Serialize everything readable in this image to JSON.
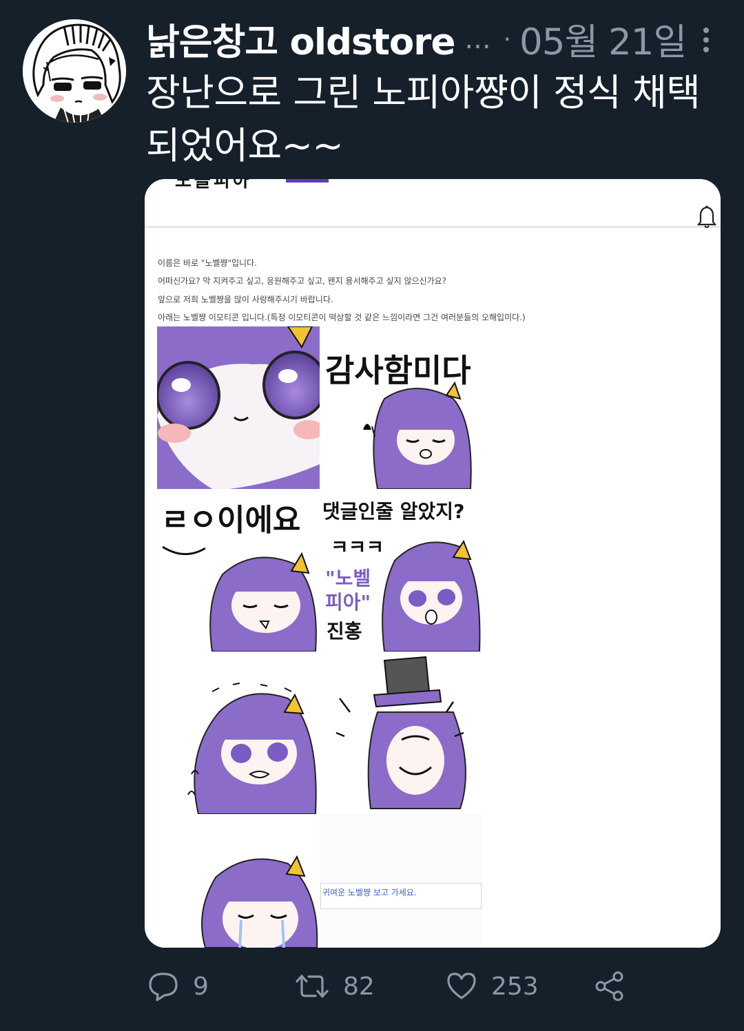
{
  "tweet": {
    "author": "낡은창고 oldstore",
    "ellipsis": "...",
    "separator": "·",
    "date": "05월 21일",
    "text": "장난으로 그린 노피아쨩이 정식 채택되었어요~~"
  },
  "card": {
    "site_title_partial": "노블피아",
    "article_lines": [
      "",
      "이름은 바로 \"노벨쨩\"입니다.",
      "어떠신가요? 막 지켜주고 싶고, 응원해주고 싶고, 왠지 용서해주고 싶지 않으신가요?",
      "앞으로 저희 노벨쨩을 많이 사랑해주시기 바랍니다.",
      "아래는 노벨쨩 이모티콘 입니다.(특정 이모티콘이 떡상할 것 같은 느낌이라면 그건 여러분들의 오해입미다.)"
    ],
    "stickers": {
      "thanks": "감사함미다",
      "ping": "ㄹㅇ이에요",
      "comment_line1": "댓글인줄 알았지?",
      "comment_line2": "ㅋㅋㅋ",
      "comment_line3a": "\"노벨",
      "comment_line3b": "피아\"",
      "comment_line4": "진홍"
    },
    "bottom_link": "귀여운 노벨쨩 보고 가세요."
  },
  "actions": {
    "replies": "9",
    "retweets": "82",
    "likes": "253"
  },
  "colors": {
    "background": "#15202b",
    "muted": "#8b98a5",
    "character_purple": "#8b6cc9",
    "accent_purple": "#5b3fb3",
    "link_blue": "#3a5fc4"
  },
  "icons": [
    "more-icon",
    "bell-icon",
    "reply-icon",
    "retweet-icon",
    "like-icon",
    "share-icon"
  ]
}
